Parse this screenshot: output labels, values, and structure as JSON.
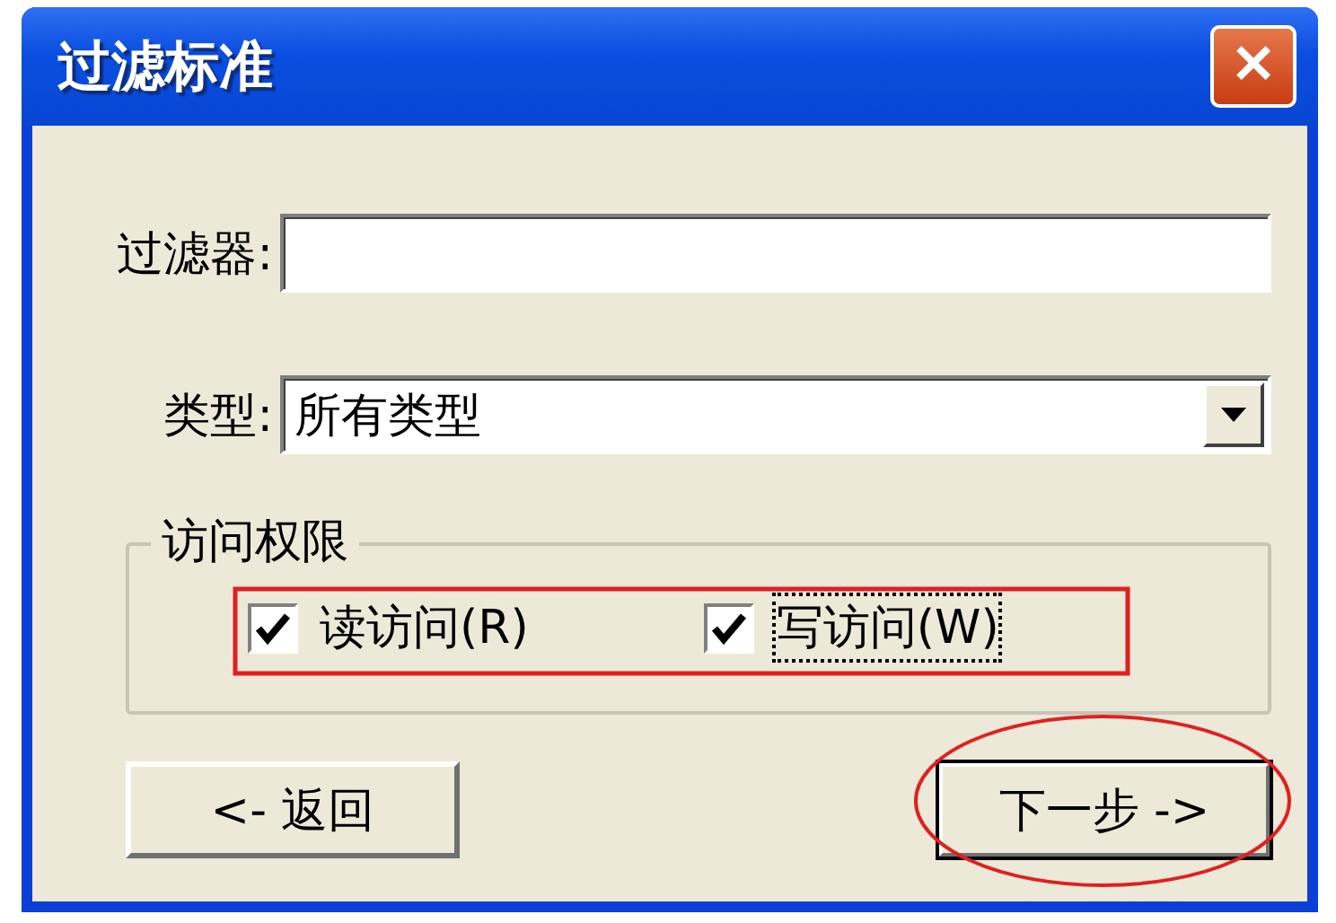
{
  "window": {
    "title": "过滤标准",
    "close_button": "✕"
  },
  "filter": {
    "label": "过滤器:"
  },
  "type": {
    "label": "类型:",
    "value": "所有类型"
  },
  "access": {
    "legend": "访问权限",
    "options": [
      {
        "label": "读访问(R)",
        "checked": true,
        "focused": false
      },
      {
        "label": "写访问(W)",
        "checked": true,
        "focused": true
      }
    ]
  },
  "buttons": [
    {
      "label": "<- 返回",
      "default": false
    },
    {
      "label": "下一步 ->",
      "default": true
    }
  ]
}
